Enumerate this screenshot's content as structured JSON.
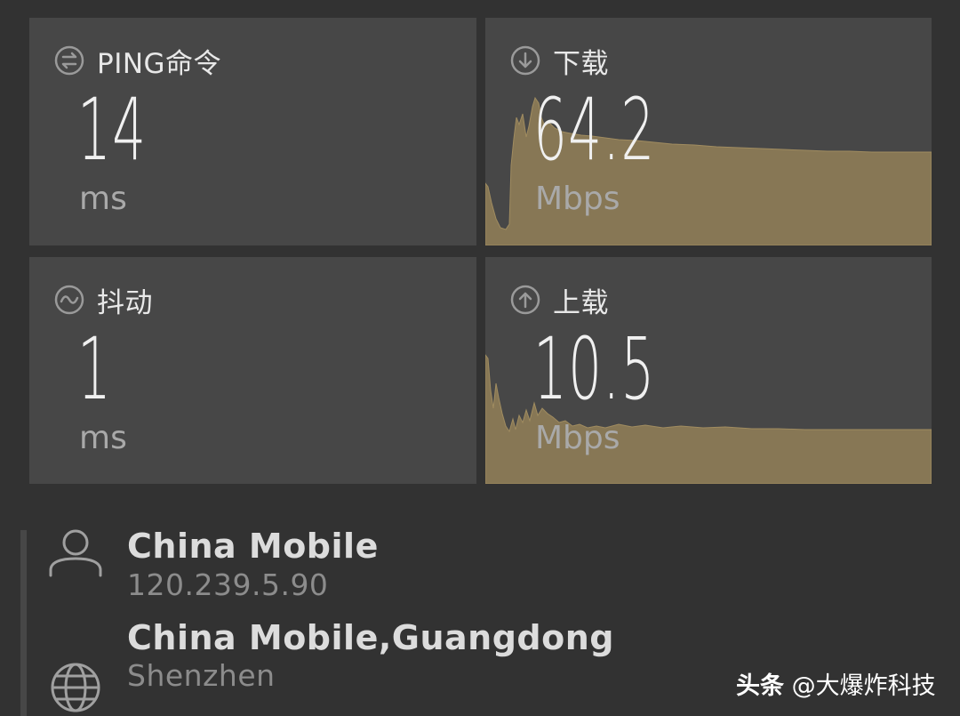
{
  "tiles": {
    "ping": {
      "label": "PING命令",
      "value": "14",
      "unit": "ms",
      "icon": "ping-icon"
    },
    "download": {
      "label": "下载",
      "value": "64.2",
      "unit": "Mbps",
      "icon": "download-arrow-icon"
    },
    "jitter": {
      "label": "抖动",
      "value": "1",
      "unit": "ms",
      "icon": "jitter-wave-icon"
    },
    "upload": {
      "label": "上载",
      "value": "10.5",
      "unit": "Mbps",
      "icon": "upload-arrow-icon"
    }
  },
  "provider": {
    "name": "China Mobile",
    "ip": "120.239.5.90",
    "icon": "user-icon"
  },
  "server": {
    "name": "China Mobile,Guangdong",
    "city": "Shenzhen",
    "icon": "globe-icon"
  },
  "watermark": {
    "prefix": "头条",
    "handle": "@大爆炸科技"
  },
  "colors": {
    "background": "#323232",
    "tile": "#474747",
    "graph_fill": "#877755",
    "graph_stroke": "#a08c60"
  }
}
